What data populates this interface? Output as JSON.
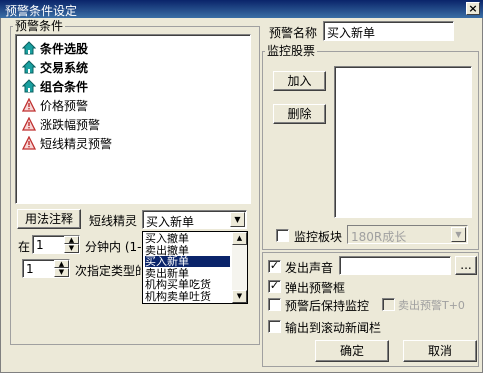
{
  "window": {
    "title": "预警条件设定",
    "close": "×"
  },
  "conditions": {
    "legend": "预警条件",
    "items": [
      {
        "label": "条件选股",
        "icon": "house-icon",
        "bold": true
      },
      {
        "label": "交易系统",
        "icon": "house-icon",
        "bold": true
      },
      {
        "label": "组合条件",
        "icon": "house-icon",
        "bold": true
      },
      {
        "label": "价格预警",
        "icon": "triangle-alert-icon",
        "bold": false
      },
      {
        "label": "涨跌幅预警",
        "icon": "triangle-alert-icon",
        "bold": false
      },
      {
        "label": "短线精灵预警",
        "icon": "triangle-alert-icon",
        "bold": false
      }
    ],
    "usage_button": "用法注释",
    "sprite_label": "短线精灵",
    "sprite_selected": "买入新单",
    "sprite_options": [
      "买入撤单",
      "卖出撤单",
      "买入新单",
      "卖出新单",
      "机构买单吃货",
      "机构卖单吐货"
    ],
    "sprite_highlight_index": 2,
    "minutes_prefix": "在",
    "minutes_value": "1",
    "minutes_text": "分钟内 (1-6",
    "times_value": "1",
    "times_text": "次指定类型的"
  },
  "alert_name": {
    "label": "预警名称",
    "value": "买入新单"
  },
  "monitor": {
    "legend": "监控股票",
    "add": "加入",
    "delete": "删除",
    "block_label": "监控板块",
    "block_value": "180R成长",
    "block_checked": false
  },
  "options": {
    "sound_label": "发出声音",
    "sound_checked": true,
    "sound_path": "",
    "browse": "...",
    "popup_label": "弹出预警框",
    "popup_checked": true,
    "keep_label": "预警后保持监控",
    "keep_checked": false,
    "sell_label": "卖出预警T+0",
    "sell_checked": false,
    "news_label": "输出到滚动新闻栏",
    "news_checked": false
  },
  "buttons": {
    "ok": "确定",
    "cancel": "取消"
  },
  "colors": {
    "title_bar": "#0a246a",
    "dialog_bg": "#ece9d8",
    "selection": "#0a246a",
    "house_icon": "#1aa0a0",
    "alert_icon": "#c03030"
  }
}
